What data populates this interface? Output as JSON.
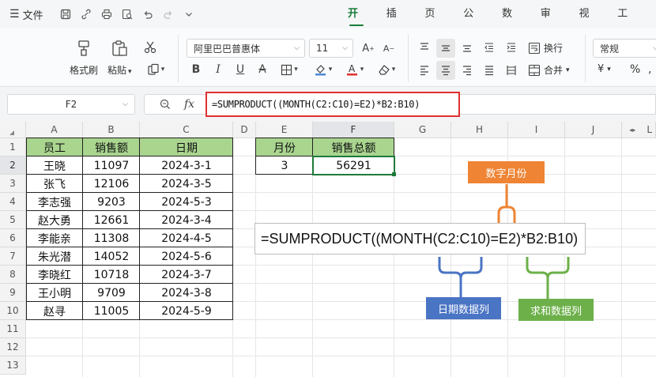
{
  "menubar": {
    "file_label": "文件",
    "tabs": [
      {
        "label": "开始",
        "active": true
      },
      {
        "label": "插入",
        "active": false
      },
      {
        "label": "页面",
        "active": false
      },
      {
        "label": "公式",
        "active": false
      },
      {
        "label": "数据",
        "active": false
      },
      {
        "label": "审阅",
        "active": false
      },
      {
        "label": "视图",
        "active": false
      },
      {
        "label": "工具",
        "active": false
      }
    ]
  },
  "ribbon": {
    "format_painter": "格式刷",
    "paste": "粘贴",
    "font_name": "阿里巴巴普惠体",
    "font_size": "11",
    "wrap_text": "换行",
    "merge": "合并",
    "number_format": "常规",
    "currency_symbol": "¥",
    "percent_symbol": "%",
    "font_color": "#e23030"
  },
  "formula_bar": {
    "name_box": "F2",
    "fx": "fx",
    "formula": "=SUMPRODUCT((MONTH(C2:C10)=E2)*B2:B10)"
  },
  "sheet": {
    "columns": [
      "A",
      "B",
      "C",
      "D",
      "E",
      "F",
      "G",
      "H",
      "I",
      "J",
      "L"
    ],
    "rows": [
      "1",
      "2",
      "3",
      "4",
      "5",
      "6",
      "7",
      "8",
      "9",
      "10",
      "11",
      "12",
      "13"
    ],
    "table_headers": [
      "员工",
      "销售额",
      "日期"
    ],
    "table_rows": [
      [
        "王晓",
        "11097",
        "2024-3-1"
      ],
      [
        "张飞",
        "12106",
        "2024-3-5"
      ],
      [
        "李志强",
        "9203",
        "2024-5-3"
      ],
      [
        "赵大勇",
        "12661",
        "2024-3-4"
      ],
      [
        "李能亲",
        "11308",
        "2024-4-5"
      ],
      [
        "朱光潜",
        "14052",
        "2024-5-6"
      ],
      [
        "李晓红",
        "10718",
        "2024-3-7"
      ],
      [
        "王小明",
        "9709",
        "2024-3-8"
      ],
      [
        "赵寻",
        "11005",
        "2024-5-9"
      ]
    ],
    "result_headers": [
      "月份",
      "销售总额"
    ],
    "result_values": [
      "3",
      "56291"
    ],
    "header_color": "#a9d58f"
  },
  "annotation": {
    "formula": "=SUMPRODUCT((MONTH(C2:C10)=E2)*B2:B10)",
    "month_label": "数字月份",
    "date_label": "日期数据列",
    "sum_label": "求和数据列",
    "colors": {
      "orange": "#ee8434",
      "blue": "#4a74c4",
      "green": "#6db04a"
    }
  }
}
